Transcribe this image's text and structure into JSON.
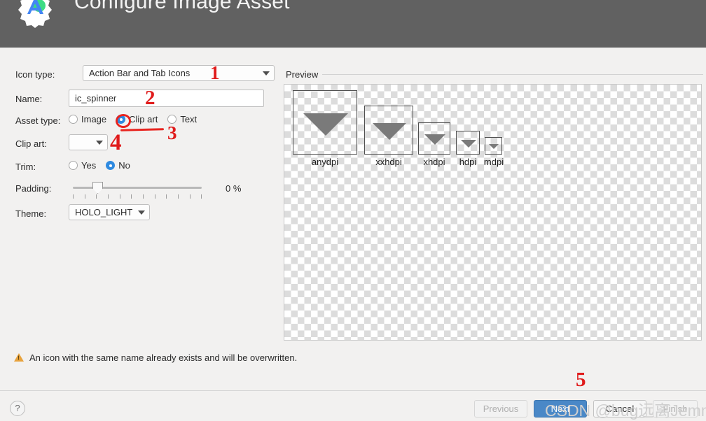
{
  "header": {
    "title": "Configure Image Asset",
    "logo_icon": "android-studio-logo"
  },
  "form": {
    "icon_type": {
      "label": "Icon type:",
      "value": "Action Bar and Tab Icons"
    },
    "name": {
      "label": "Name:",
      "value": "ic_spinner"
    },
    "asset_type": {
      "label": "Asset type:",
      "options": [
        "Image",
        "Clip art",
        "Text"
      ],
      "selected": "Clip art"
    },
    "clip_art": {
      "label": "Clip art:",
      "value": ""
    },
    "trim": {
      "label": "Trim:",
      "options": [
        "Yes",
        "No"
      ],
      "selected": "No"
    },
    "padding": {
      "label": "Padding:",
      "value": "0 %",
      "percent": 0
    },
    "theme": {
      "label": "Theme:",
      "value": "HOLO_LIGHT"
    }
  },
  "preview": {
    "title": "Preview",
    "tiles": [
      {
        "label": "anydpi",
        "size": 92
      },
      {
        "label": "xxhdpi",
        "size": 70
      },
      {
        "label": "xhdpi",
        "size": 46
      },
      {
        "label": "hdpi",
        "size": 34
      },
      {
        "label": "mdpi",
        "size": 25
      }
    ]
  },
  "warning": {
    "icon": "warning-triangle-icon",
    "text": "An icon with the same name already exists and will be overwritten."
  },
  "footer": {
    "help_label": "?",
    "previous_label": "Previous",
    "next_label": "Next",
    "cancel_label": "Cancel",
    "finish_label": "Finish"
  },
  "annotations": [
    {
      "text": "1"
    },
    {
      "text": "2"
    },
    {
      "text": "3"
    },
    {
      "text": "4"
    },
    {
      "text": "5"
    }
  ],
  "watermark": {
    "text": "CSDN @bug远离Jemma"
  },
  "colors": {
    "header_bg": "#616161",
    "body_bg": "#f2f1f0",
    "accent_blue": "#2f8ae0",
    "primary_button": "#4a88c7",
    "annotation_red": "#e8241f",
    "warning_orange": "#e8a33d"
  }
}
